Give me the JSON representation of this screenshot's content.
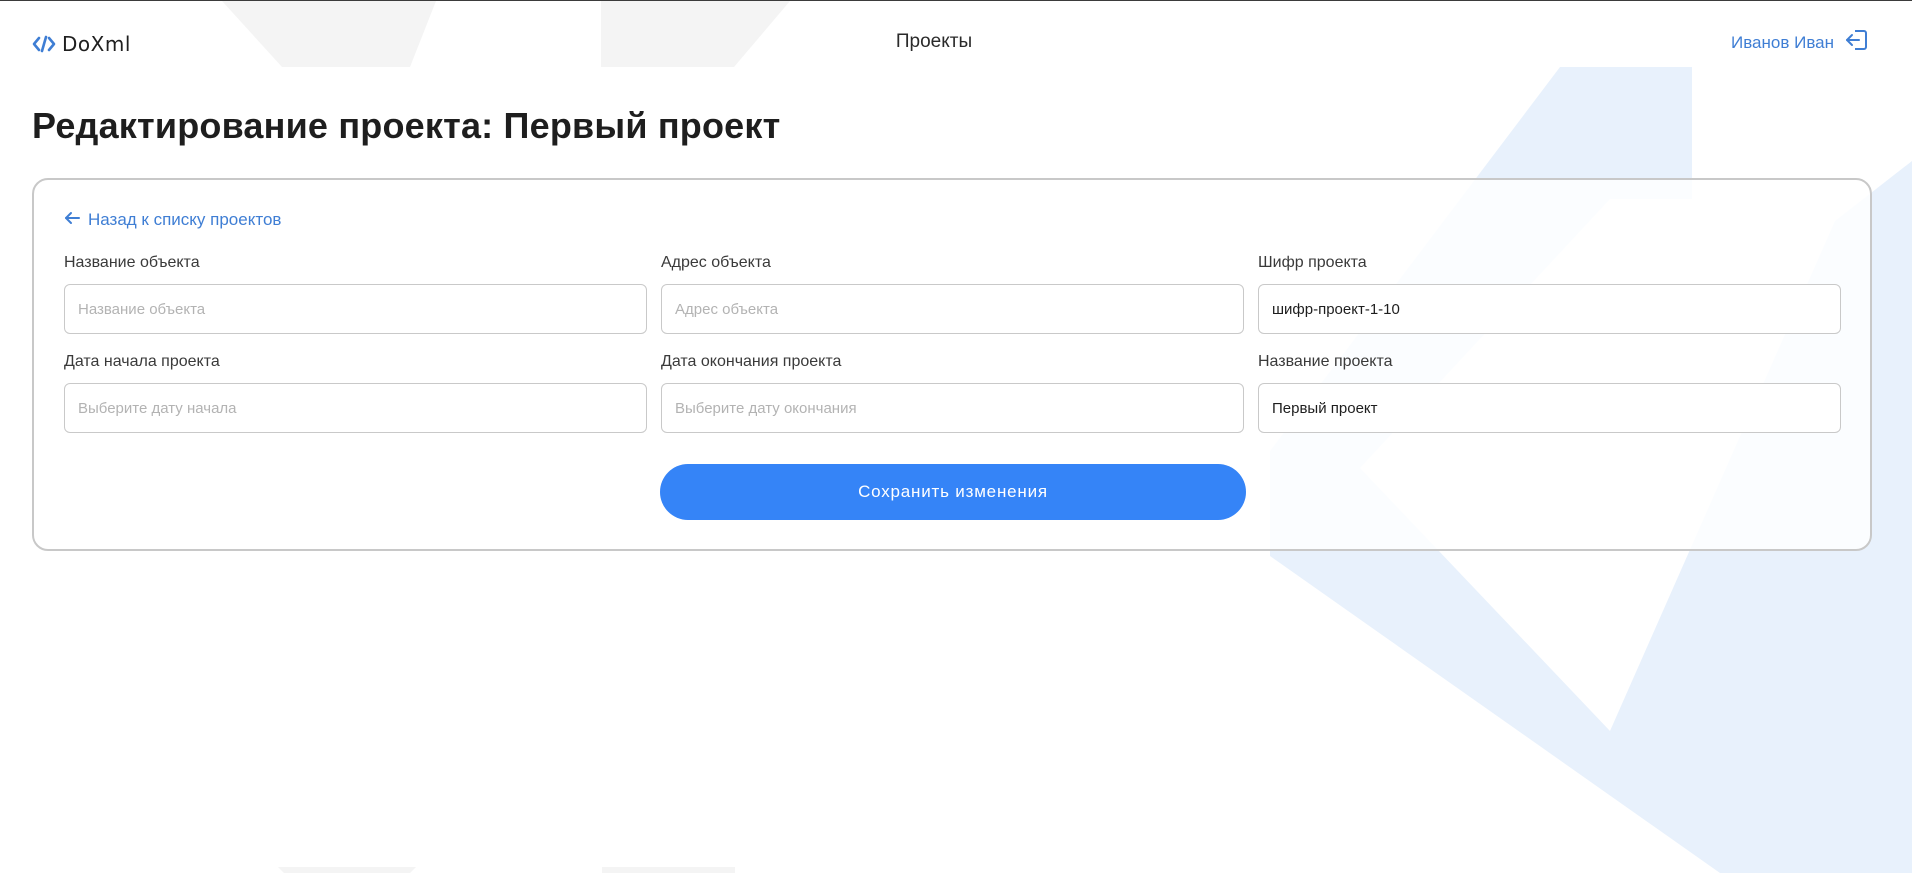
{
  "header": {
    "logo_text": "DoXml",
    "nav_projects": "Проекты",
    "user_name": "Иванов Иван"
  },
  "page": {
    "title": "Редактирование проекта: Первый проект"
  },
  "form": {
    "back_link": "Назад к списку проектов",
    "object_name": {
      "label": "Название объекта",
      "placeholder": "Название объекта",
      "value": ""
    },
    "object_address": {
      "label": "Адрес объекта",
      "placeholder": "Адрес объекта",
      "value": ""
    },
    "project_code": {
      "label": "Шифр проекта",
      "placeholder": "",
      "value": "шифр-проект-1-10"
    },
    "start_date": {
      "label": "Дата начала проекта",
      "placeholder": "Выберите дату начала",
      "value": ""
    },
    "end_date": {
      "label": "Дата окончания проекта",
      "placeholder": "Выберите дату окончания",
      "value": ""
    },
    "project_name": {
      "label": "Название проекта",
      "placeholder": "",
      "value": "Первый проект"
    },
    "save_label": "Сохранить изменения"
  },
  "colors": {
    "accent": "#3584f7",
    "link": "#3f7ed4",
    "background_shape": "#e8f1fc"
  },
  "icons": {
    "logo": "code-icon",
    "logout": "logout-icon",
    "back": "arrow-left-icon"
  }
}
